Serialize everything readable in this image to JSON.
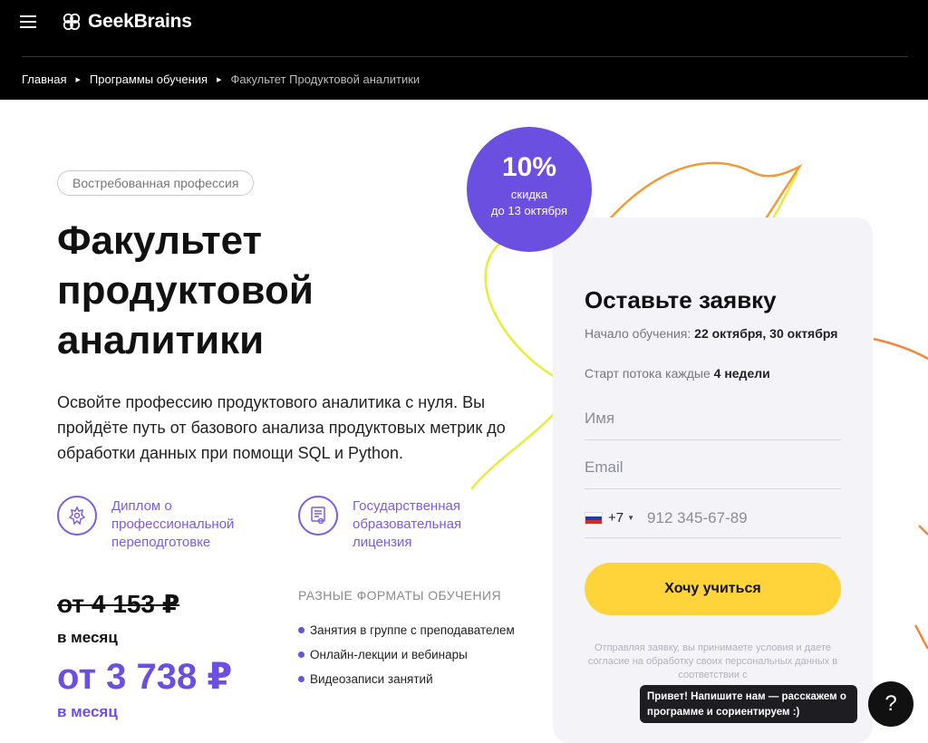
{
  "header": {
    "logo_text": "GeekBrains",
    "breadcrumbs": [
      "Главная",
      "Программы обучения",
      "Факультет Продуктовой аналитики"
    ]
  },
  "hero": {
    "tag": "Востребованная профессия",
    "title": "Факультет продуктовой аналитики",
    "description": "Освойте профессию продуктового аналитика с нуля. Вы пройдёте путь от базового анализа продуктовых метрик до обработки данных при помощи SQL и Python.",
    "features": [
      {
        "icon": "emblem-icon",
        "text": "Диплом о профессиональной переподготовке"
      },
      {
        "icon": "license-icon",
        "text": "Государственная образовательная лицензия"
      }
    ]
  },
  "price": {
    "old": "от 4 153 ₽",
    "old_period": "в месяц",
    "new": "от 3 738 ₽",
    "new_period": "в месяц"
  },
  "formats": {
    "title": "РАЗНЫЕ ФОРМАТЫ ОБУЧЕНИЯ",
    "items": [
      "Занятия в группе с преподавателем",
      "Онлайн-лекции и вебинары",
      "Видеозаписи занятий"
    ]
  },
  "badge": {
    "percent": "10%",
    "line1": "скидка",
    "line2": "до 13 октября"
  },
  "form": {
    "title": "Оставьте заявку",
    "start_label": "Начало обучения: ",
    "start_value": "22 октября, 30 октября",
    "stream_label": "Старт потока каждые ",
    "stream_value": "4 недели",
    "name_placeholder": "Имя",
    "email_placeholder": "Email",
    "phone_code": "+7",
    "phone_placeholder": "912 345-67-89",
    "submit": "Хочу учиться",
    "consent": "Отправляя заявку, вы принимаете условия и даете согласие на обработку своих персональных данных в соответствии с"
  },
  "chat": {
    "tooltip": "Привет! Напишите нам — расскажем о программе и сориентируем :)",
    "button": "?"
  },
  "colors": {
    "accent": "#6b4fe0",
    "button": "#ffd43b",
    "header_bg": "#000000"
  }
}
